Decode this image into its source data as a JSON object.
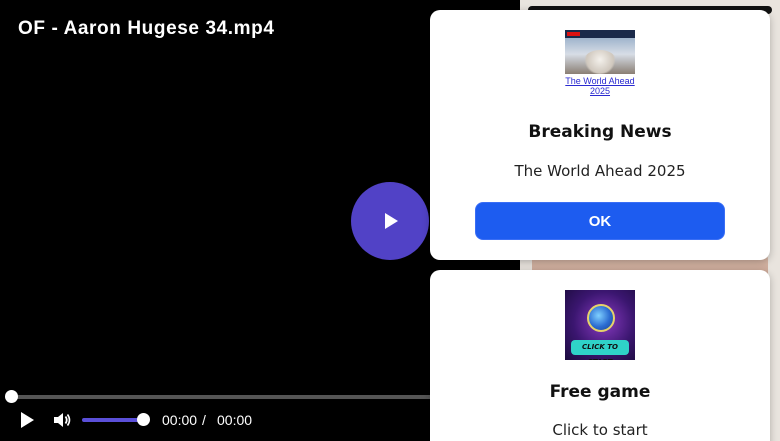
{
  "player": {
    "title": "OF - Aaron Hugese 34.mp4",
    "current_time": "00:00",
    "time_separator": "/",
    "duration": "00:00",
    "progress_fraction": 0.0,
    "volume_fraction": 1.0,
    "accent_color": "#5142c6"
  },
  "popups": {
    "news": {
      "thumb_caption": "The World Ahead 2025",
      "title": "Breaking News",
      "subtitle": "The World Ahead 2025",
      "button_label": "OK",
      "button_color": "#1d5cf0"
    },
    "game": {
      "thumb_caption": "CLICK TO START",
      "title": "Free game",
      "subtitle": "Click to start"
    }
  },
  "icons": {
    "big_play": "play-icon",
    "control_play": "play-icon",
    "volume": "volume-icon"
  }
}
